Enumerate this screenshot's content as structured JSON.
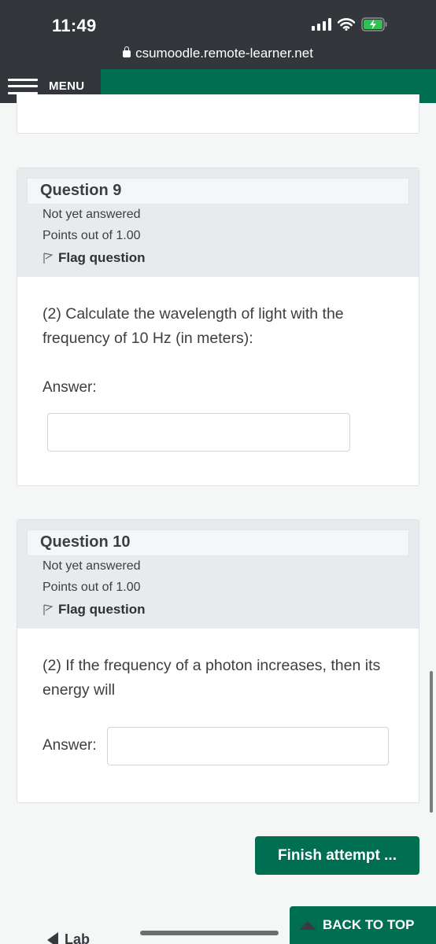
{
  "status_bar": {
    "time": "11:49",
    "url": "csumoodle.remote-learner.net",
    "icons": [
      "signal-icon",
      "wifi-icon",
      "battery-charging-icon"
    ]
  },
  "navbar": {
    "menu_label": "MENU"
  },
  "questions": [
    {
      "title": "Question 9",
      "status": "Not yet answered",
      "points": "Points out of 1.00",
      "flag_label": "Flag question",
      "text": "(2) Calculate the wavelength of light with the frequency of 10 Hz (in meters):",
      "answer_label": "Answer:",
      "answer_value": "",
      "answer_placeholder": ""
    },
    {
      "title": "Question 10",
      "status": "Not yet answered",
      "points": "Points out of 1.00",
      "flag_label": "Flag question",
      "text": "(2) If the frequency of a photon increases, then its energy will",
      "answer_label": "Answer:",
      "answer_value": "",
      "answer_placeholder": ""
    }
  ],
  "footer": {
    "finish_label": "Finish attempt ...",
    "back_to_top_label": "BACK TO TOP",
    "prev_link_label": "Lab"
  },
  "colors": {
    "brand": "#006f51",
    "header_dark": "#33363a"
  }
}
